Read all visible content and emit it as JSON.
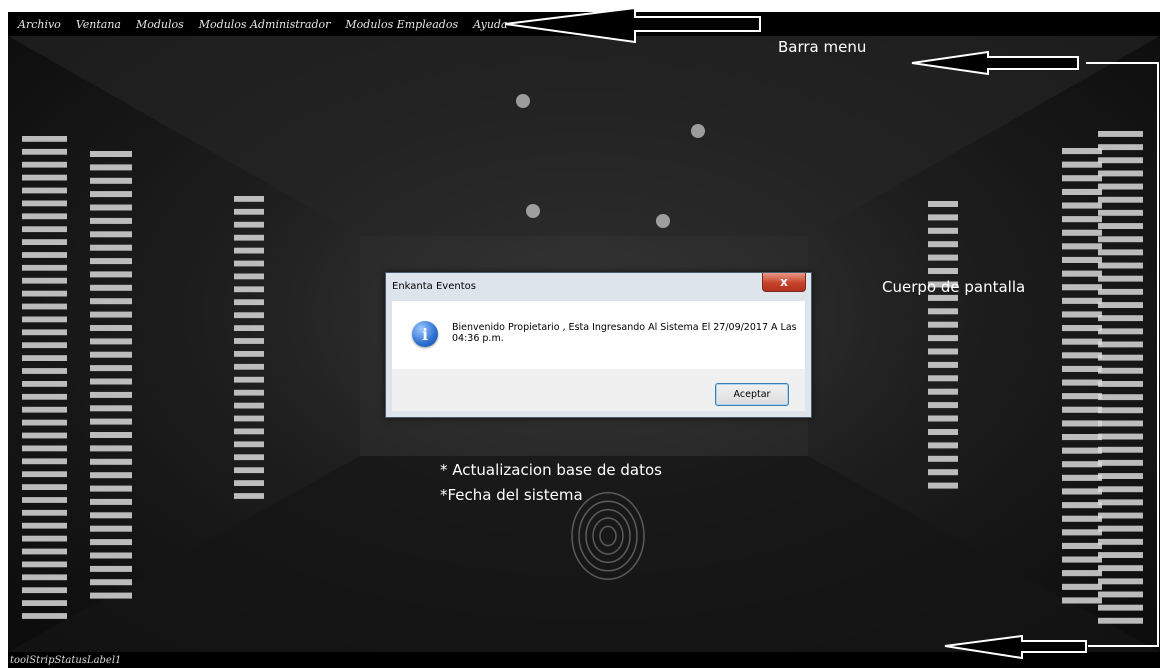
{
  "menu": {
    "items": [
      "Archivo",
      "Ventana",
      "Modulos",
      "Modulos Administrador",
      "Modulos Empleados",
      "Ayuda"
    ]
  },
  "status": {
    "label": "toolStripStatusLabel1"
  },
  "dialog": {
    "title": "Enkanta Eventos",
    "close": "x",
    "message": "Bienvenido Propietario , Esta Ingresando Al Sistema El 27/09/2017 A Las 04:36 p.m.",
    "button": "Aceptar"
  },
  "annotations": {
    "menu_label": "Barra menu",
    "body_label": "Cuerpo de pantalla",
    "notes": [
      "* Actualizacion base de datos",
      "*Fecha del sistema"
    ]
  },
  "icons": {
    "dialog_icon": "info-icon",
    "close_icon": "close-icon"
  },
  "colors": {
    "menubar": "#000000",
    "dialog_bg": "#dde4ec",
    "close": "#c8432b",
    "annotation_text": "#ffffff"
  }
}
